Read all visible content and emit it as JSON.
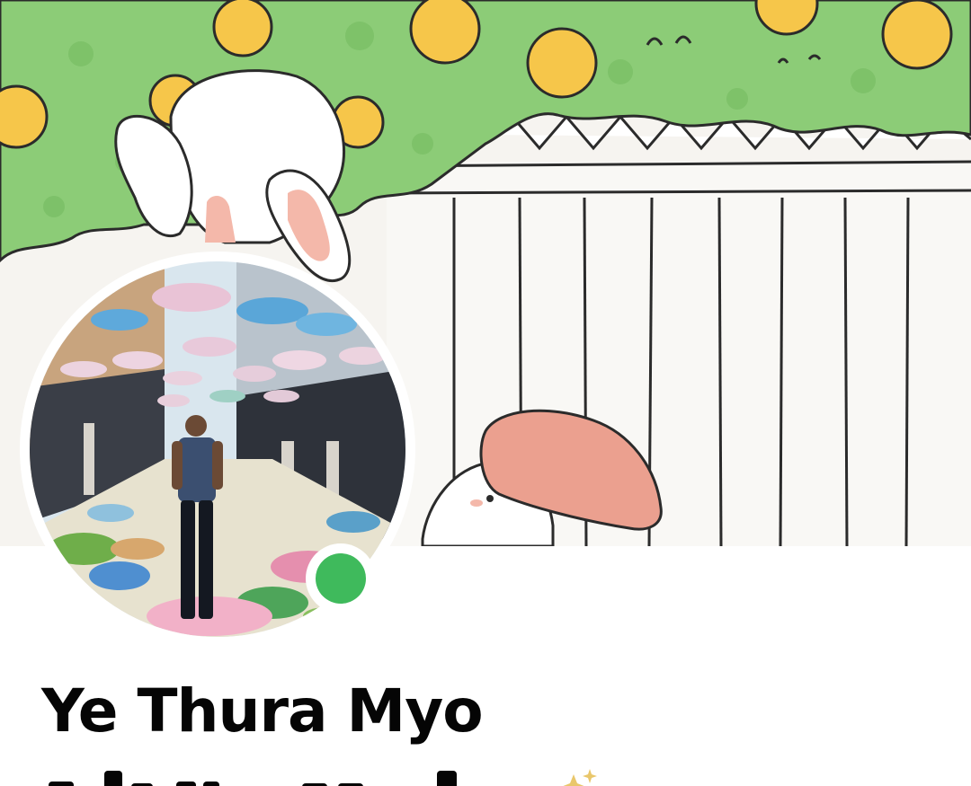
{
  "profile": {
    "name": "Ye Thura Myo",
    "bio_partial": "",
    "online_status": "online",
    "status_color": "#3fba5c"
  },
  "cover": {
    "description_icon": "cartoon-bunny-cover-image"
  },
  "avatar": {
    "icon": "profile-photo-avatar"
  }
}
